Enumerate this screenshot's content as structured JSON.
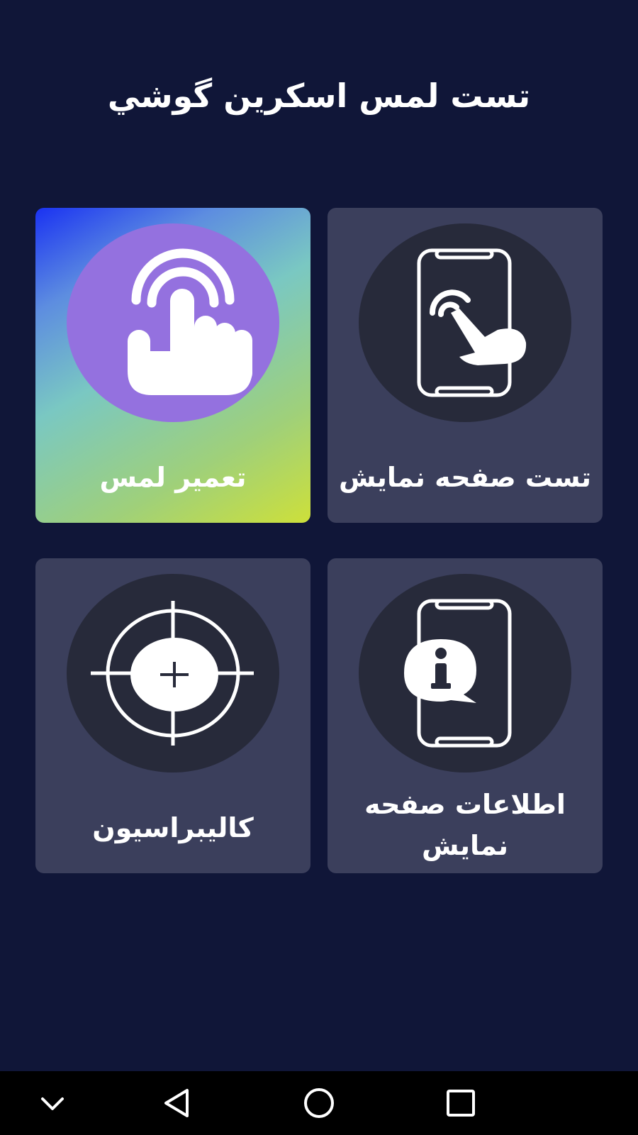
{
  "header": {
    "title": "تست لمس اسکرین گوشي"
  },
  "cards": {
    "touch_repair": {
      "label": "تعمیر لمس",
      "icon": "tap-hand-icon",
      "highlighted": true
    },
    "display_test": {
      "label": "تست صفحه نمایش",
      "icon": "phone-touch-icon",
      "highlighted": false
    },
    "calibration": {
      "label": "کالیبراسیون",
      "icon": "crosshair-icon",
      "highlighted": false
    },
    "display_info": {
      "label": "اطلاعات صفحه نمایش",
      "icon": "phone-info-icon",
      "highlighted": false
    }
  },
  "navbar": {
    "buttons": [
      "hide-keyboard-icon",
      "back-icon",
      "home-icon",
      "recents-icon"
    ]
  },
  "colors": {
    "background": "#101638",
    "card": "#3b3f5c",
    "icon_circle": "#272a3a",
    "highlight_circle": "#9471df"
  }
}
